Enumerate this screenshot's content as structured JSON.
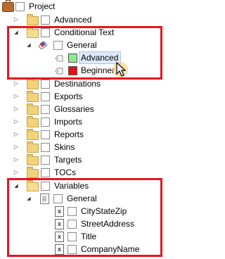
{
  "tree": {
    "root": {
      "label": "Project",
      "icon": "briefcase-icon"
    },
    "items": [
      {
        "label": "Advanced"
      },
      {
        "label": "Conditional Text",
        "group": "General",
        "conditions": [
          {
            "label": "Advanced",
            "color": "#90e890"
          },
          {
            "label": "Beginner",
            "color": "#e81010"
          }
        ]
      },
      {
        "label": "Destinations"
      },
      {
        "label": "Exports"
      },
      {
        "label": "Glossaries"
      },
      {
        "label": "Imports"
      },
      {
        "label": "Reports"
      },
      {
        "label": "Skins"
      },
      {
        "label": "Targets"
      },
      {
        "label": "TOCs"
      },
      {
        "label": "Variables",
        "group": "General",
        "variables": [
          {
            "label": "CityStateZip"
          },
          {
            "label": "StreetAddress"
          },
          {
            "label": "Title"
          },
          {
            "label": "CompanyName"
          }
        ]
      }
    ]
  },
  "annotations": {
    "highlight_color": "#e8141e"
  }
}
